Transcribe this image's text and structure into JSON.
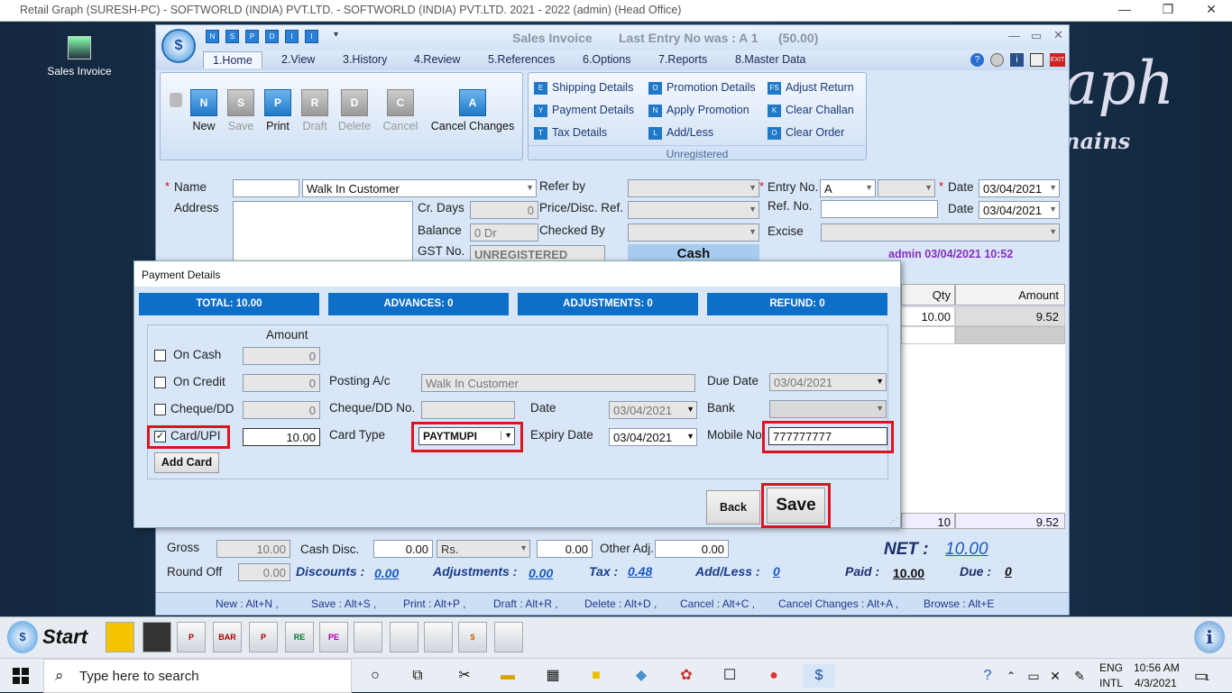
{
  "window": {
    "title": "Retail Graph (SURESH-PC) - SOFTWORLD (INDIA) PVT.LTD. - SOFTWORLD (INDIA) PVT.LTD.  2021 - 2022 (admin) (Head Office)",
    "min": "—",
    "restore": "❐",
    "close": "✕"
  },
  "desktop": {
    "icon_label": "Sales Invoice",
    "brand_text": "aph",
    "brand_sub": "nains"
  },
  "invoice": {
    "title": "Sales Invoice",
    "last_entry": "Last Entry No was : A 1",
    "amount": "(50.00)",
    "qa_icons": [
      "N",
      "S",
      "P",
      "D",
      "I",
      "I"
    ],
    "tabs": [
      "1.Home",
      "2.View",
      "3.History",
      "4.Review",
      "5.References",
      "6.Options",
      "7.Reports",
      "8.Master Data"
    ],
    "ribbon_buttons": [
      {
        "label": "New",
        "ic": "N"
      },
      {
        "label": "Save",
        "ic": "S"
      },
      {
        "label": "Print",
        "ic": "P"
      },
      {
        "label": "Draft",
        "ic": "R"
      },
      {
        "label": "Delete",
        "ic": "D"
      },
      {
        "label": "Cancel",
        "ic": "C"
      },
      {
        "label": "Cancel Changes",
        "ic": "A"
      }
    ],
    "ribbon_links": [
      [
        "Shipping Details",
        "Promotion Details",
        "Adjust Return"
      ],
      [
        "Payment Details",
        "Apply Promotion",
        "Clear Challan"
      ],
      [
        "Tax Details",
        "Add/Less",
        "Clear Order"
      ]
    ],
    "ribbon_link_icons": [
      [
        "E",
        "O",
        "FS"
      ],
      [
        "Y",
        "N",
        "K"
      ],
      [
        "T",
        "L",
        "O"
      ]
    ],
    "unregistered": "Unregistered",
    "form": {
      "name_label": "Name",
      "name_value": "Walk In Customer",
      "address_label": "Address",
      "cr_days_label": "Cr. Days",
      "cr_days": "0",
      "balance_label": "Balance",
      "balance": "0 Dr",
      "gst_label": "GST No.",
      "gst": "UNREGISTERED",
      "refer_by": "Refer by",
      "price_disc": "Price/Disc. Ref.",
      "checked_by": "Checked By",
      "cash": "Cash",
      "entry_no_label": "Entry No.",
      "entry_series": "A",
      "date_label": "Date",
      "date": "03/04/2021",
      "ref_no_label": "Ref. No.",
      "excise_label": "Excise",
      "stamp": "admin 03/04/2021 10:52"
    },
    "grid": {
      "qty_header": "Qty",
      "amount_header": "Amount",
      "qty": "10.00",
      "amount": "9.52",
      "total_qty": "10",
      "total_amount": "9.52"
    },
    "footer": {
      "gross_label": "Gross",
      "gross": "10.00",
      "cash_disc_label": "Cash Disc.",
      "cash_disc": "0.00",
      "rs": "Rs.",
      "rs_value": "0.00",
      "other_adj_label": "Other Adj.",
      "other_adj": "0.00",
      "net_label": "NET :",
      "net": "10.00",
      "round_off_label": "Round Off",
      "round_off": "0.00",
      "discounts_label": "Discounts :",
      "discounts": "0.00",
      "adjustments_label": "Adjustments :",
      "adjustments": "0.00",
      "tax_label": "Tax :",
      "tax": "0.48",
      "addless_label": "Add/Less :",
      "addless": "0",
      "paid_label": "Paid :",
      "paid": "10.00",
      "due_label": "Due :",
      "due": "0"
    },
    "shortcuts": [
      "New : Alt+N ,",
      "Save : Alt+S ,",
      "Print : Alt+P ,",
      "Draft : Alt+R ,",
      "Delete : Alt+D ,",
      "Cancel : Alt+C ,",
      "Cancel Changes : Alt+A ,",
      "Browse : Alt+E"
    ]
  },
  "payment": {
    "title": "Payment Details",
    "bands": [
      "TOTAL: 10.00",
      "ADVANCES: 0",
      "ADJUSTMENTS: 0",
      "REFUND: 0"
    ],
    "amount_header": "Amount",
    "on_cash": "On Cash",
    "on_cash_amt": "0",
    "on_credit": "On Credit",
    "on_credit_amt": "0",
    "posting_label": "Posting A/c",
    "posting": "Walk In Customer",
    "due_date_label": "Due Date",
    "due_date": "03/04/2021",
    "cheque": "Cheque/DD",
    "cheque_amt": "0",
    "cheque_no_label": "Cheque/DD No.",
    "date_label": "Date",
    "cheque_date": "03/04/2021",
    "bank_label": "Bank",
    "card": "Card/UPI",
    "card_checked": "✓",
    "card_amt": "10.00",
    "card_type_label": "Card Type",
    "card_type": "PAYTMUPI",
    "expiry_label": "Expiry Date",
    "expiry": "03/04/2021",
    "mobile_label": "Mobile No",
    "mobile": "777777777",
    "add_card": "Add Card",
    "back": "Back",
    "save": "Save"
  },
  "tray": {
    "search_placeholder": "Type here to search",
    "lang1": "ENG",
    "lang2": "INTL",
    "time": "10:56 AM",
    "date": "4/3/2021",
    "notif": "1"
  },
  "start_label": "Start",
  "quick_icons": [
    "",
    "",
    "P",
    "BAR",
    "P",
    "RE",
    "PE",
    "",
    "",
    "",
    "$",
    "",
    ""
  ]
}
